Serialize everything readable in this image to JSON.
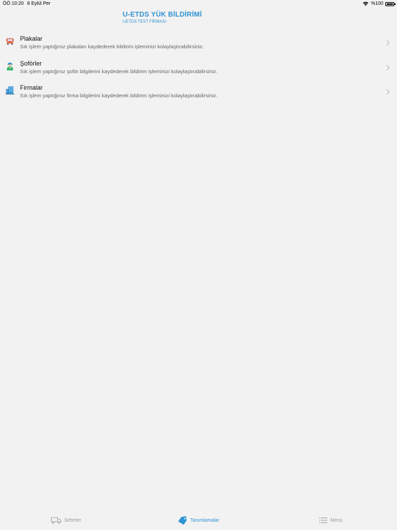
{
  "status_bar": {
    "time": "ÖÖ 10:20",
    "date": "8 Eylül Per",
    "battery": "%100"
  },
  "header": {
    "title": "U-ETDS YÜK BİLDİRİMİ",
    "subtitle": "UETDS TEST FİRMASI"
  },
  "items": [
    {
      "title": "Plakalar",
      "description": "Sık işlem yaptığınız plakaları kaydederek bildirim işleminizi kolaylaştırabilirsiniz.",
      "icon": "truck-icon"
    },
    {
      "title": "Şoförler",
      "description": "Sık işlem yaptığınız şoför bilgilerini kaydederek bildirim işleminizi kolaylaştırabilirsiniz.",
      "icon": "driver-icon"
    },
    {
      "title": "Firmalar",
      "description": "Sık işlem yaptığınız firma bilgilerini kaydederek bildirim işleminizi kolaylaştırabilirsiniz.",
      "icon": "building-icon"
    }
  ],
  "tabs": [
    {
      "label": "Seferler",
      "icon": "truck-outline-icon"
    },
    {
      "label": "Tanımlamalar",
      "icon": "tag-icon"
    },
    {
      "label": "Menü",
      "icon": "list-icon"
    }
  ],
  "colors": {
    "accent": "#2f93d1",
    "background": "#f2f2f2",
    "inactive_tab": "#9a9a9a"
  }
}
